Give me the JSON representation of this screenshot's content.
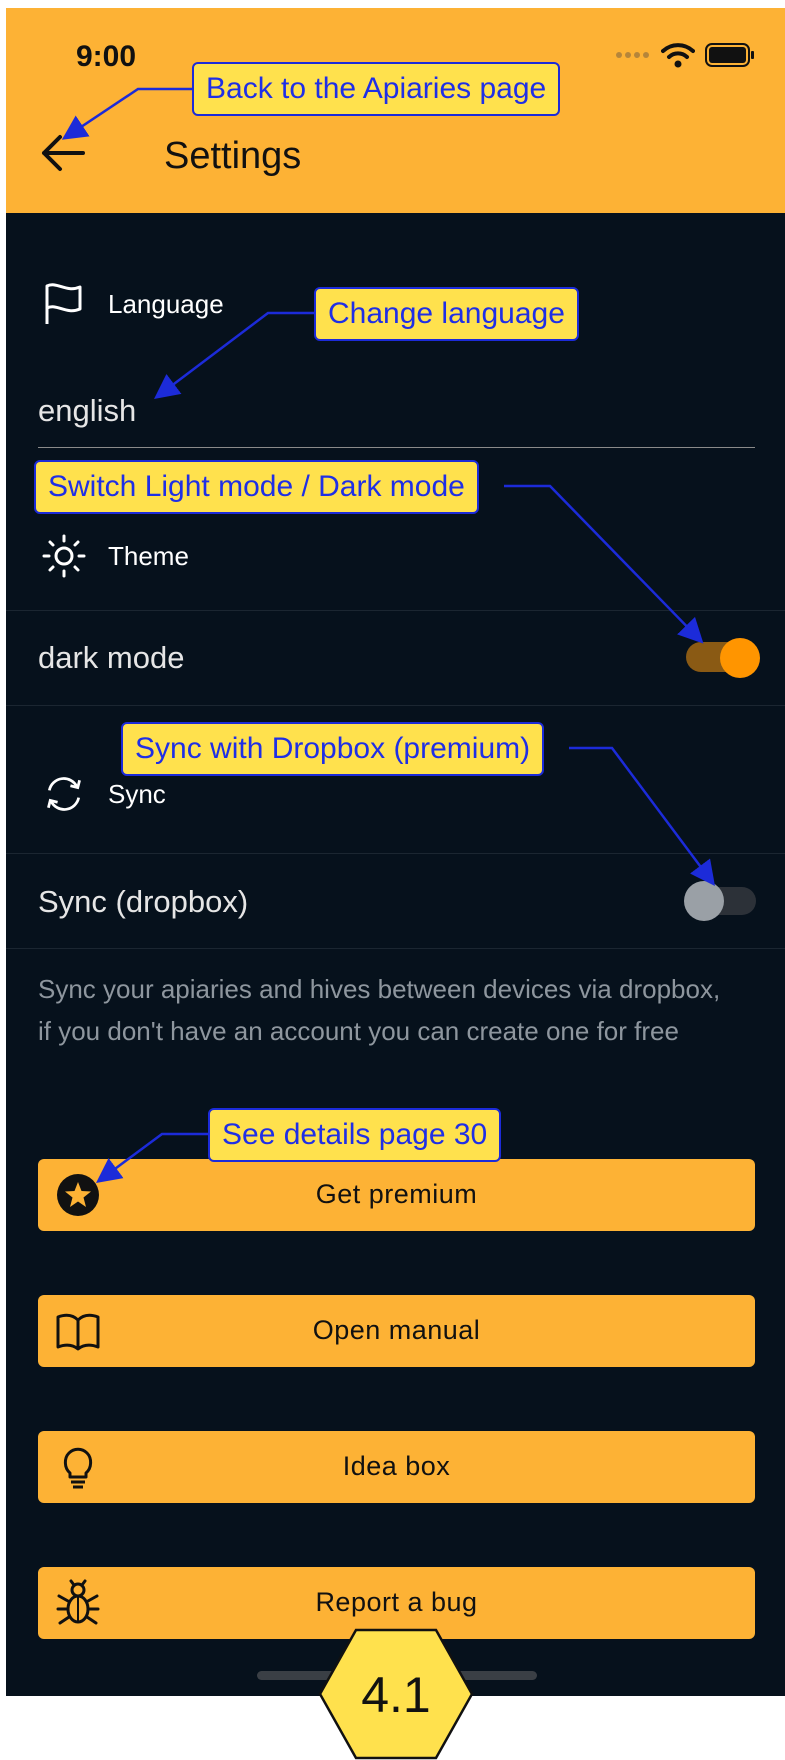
{
  "status_bar": {
    "time": "9:00"
  },
  "app_bar": {
    "title": "Settings"
  },
  "language": {
    "header": "Language",
    "value": "english"
  },
  "theme": {
    "header": "Theme",
    "label": "dark mode",
    "on": true
  },
  "sync": {
    "header": "Sync",
    "label": "Sync (dropbox)",
    "on": false,
    "description": "Sync your apiaries and hives between devices via dropbox, if you don't have an account you can create one for free"
  },
  "buttons": [
    {
      "label": "Get premium",
      "icon": "star-icon"
    },
    {
      "label": "Open manual",
      "icon": "book-icon"
    },
    {
      "label": "Idea box",
      "icon": "lightbulb-icon"
    },
    {
      "label": "Report a bug",
      "icon": "bug-icon"
    }
  ],
  "annotations": {
    "back": "Back to the Apiaries page",
    "language": "Change language",
    "theme": "Switch Light mode / Dark mode",
    "sync": "Sync with Dropbox (premium)",
    "premium": "See details page 30"
  },
  "badge": "4.1",
  "colors": {
    "accent": "#fdb235",
    "background": "#06111c",
    "toggle_on": "#ff9500",
    "annotation_text": "#1f2fe6",
    "annotation_fill": "#ffe14d"
  }
}
